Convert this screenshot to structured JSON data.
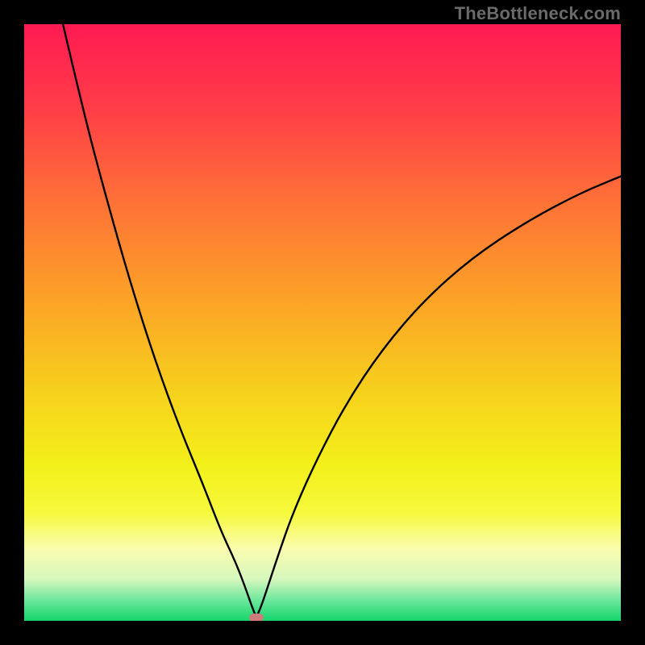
{
  "watermark": "TheBottleneck.com",
  "colors": {
    "frame": "#000000",
    "watermark": "#6a6a6a",
    "curve": "#000000",
    "marker": "#cf7a7b",
    "gradient_stops": [
      {
        "offset": 0.0,
        "color": "#ff1a52"
      },
      {
        "offset": 0.14,
        "color": "#ff3d48"
      },
      {
        "offset": 0.3,
        "color": "#fe7237"
      },
      {
        "offset": 0.46,
        "color": "#fca227"
      },
      {
        "offset": 0.62,
        "color": "#f6d21c"
      },
      {
        "offset": 0.74,
        "color": "#f3f01a"
      },
      {
        "offset": 0.82,
        "color": "#f6f93e"
      },
      {
        "offset": 0.88,
        "color": "#fafdb0"
      },
      {
        "offset": 0.93,
        "color": "#d6f7bd"
      },
      {
        "offset": 0.965,
        "color": "#6fe79d"
      },
      {
        "offset": 1.0,
        "color": "#13d66a"
      }
    ]
  },
  "chart_data": {
    "type": "line",
    "title": "",
    "xlabel": "",
    "ylabel": "",
    "xlim": [
      0,
      100
    ],
    "ylim": [
      0,
      100
    ],
    "grid": false,
    "legend": false,
    "marker": {
      "x": 38.9,
      "y": 0.6,
      "shape": "rounded-pill",
      "color": "#cf7a7b"
    },
    "series": [
      {
        "name": "bottleneck-curve",
        "color": "#000000",
        "x": [
          6.5,
          10,
          14,
          18,
          22,
          26,
          30,
          33,
          35.5,
          37.2,
          38.2,
          38.9,
          39.6,
          40.6,
          42.4,
          45,
          49,
          54,
          60,
          67,
          75,
          84,
          93,
          100
        ],
        "y": [
          100,
          85,
          70,
          56,
          43.5,
          32.5,
          22.8,
          15,
          9.7,
          5.2,
          2.3,
          0.6,
          2.1,
          5,
          10.5,
          18,
          27,
          36.5,
          45.5,
          53.7,
          60.8,
          66.8,
          71.6,
          74.5
        ]
      }
    ]
  }
}
